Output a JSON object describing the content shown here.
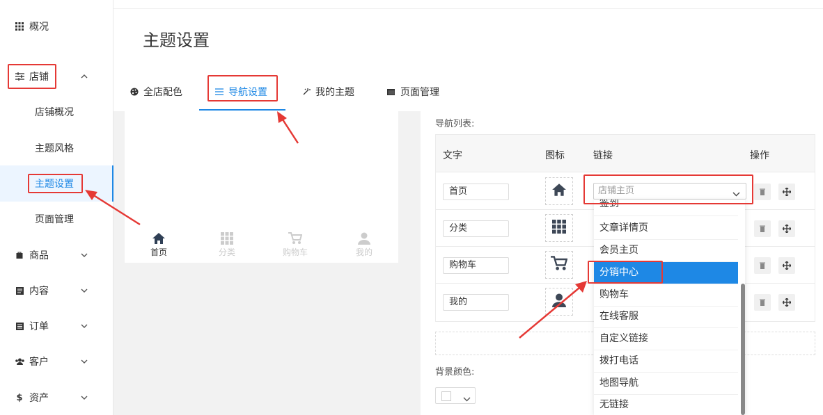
{
  "sidebar": {
    "overview": "概况",
    "store": "店铺",
    "store_sub": [
      "店铺概况",
      "主题风格",
      "主题设置",
      "页面管理"
    ],
    "goods": "商品",
    "content": "内容",
    "orders": "订单",
    "customers": "客户",
    "assets": "资产"
  },
  "page_title": "主题设置",
  "tabs": [
    "全店配色",
    "导航设置",
    "我的主题",
    "页面管理"
  ],
  "active_tab": "导航设置",
  "preview_nav": [
    "首页",
    "分类",
    "购物车",
    "我的"
  ],
  "nav_list": {
    "label": "导航列表:",
    "headers": [
      "文字",
      "图标",
      "链接",
      "操作"
    ],
    "rows": [
      {
        "text": "首页",
        "icon": "home-icon"
      },
      {
        "text": "分类",
        "icon": "grid-icon"
      },
      {
        "text": "购物车",
        "icon": "cart-icon"
      },
      {
        "text": "我的",
        "icon": "user-icon"
      }
    ]
  },
  "link_select": {
    "value": "店铺主页"
  },
  "dropdown": {
    "options": [
      "签到",
      "文章详情页",
      "会员主页",
      "分销中心",
      "购物车",
      "在线客服",
      "自定义链接",
      "拨打电话",
      "地图导航",
      "无链接"
    ],
    "selected": "分销中心"
  },
  "bg_color_label": "背景颜色:",
  "colors": {
    "accent": "#1e88e5",
    "annotation": "#e53935"
  }
}
